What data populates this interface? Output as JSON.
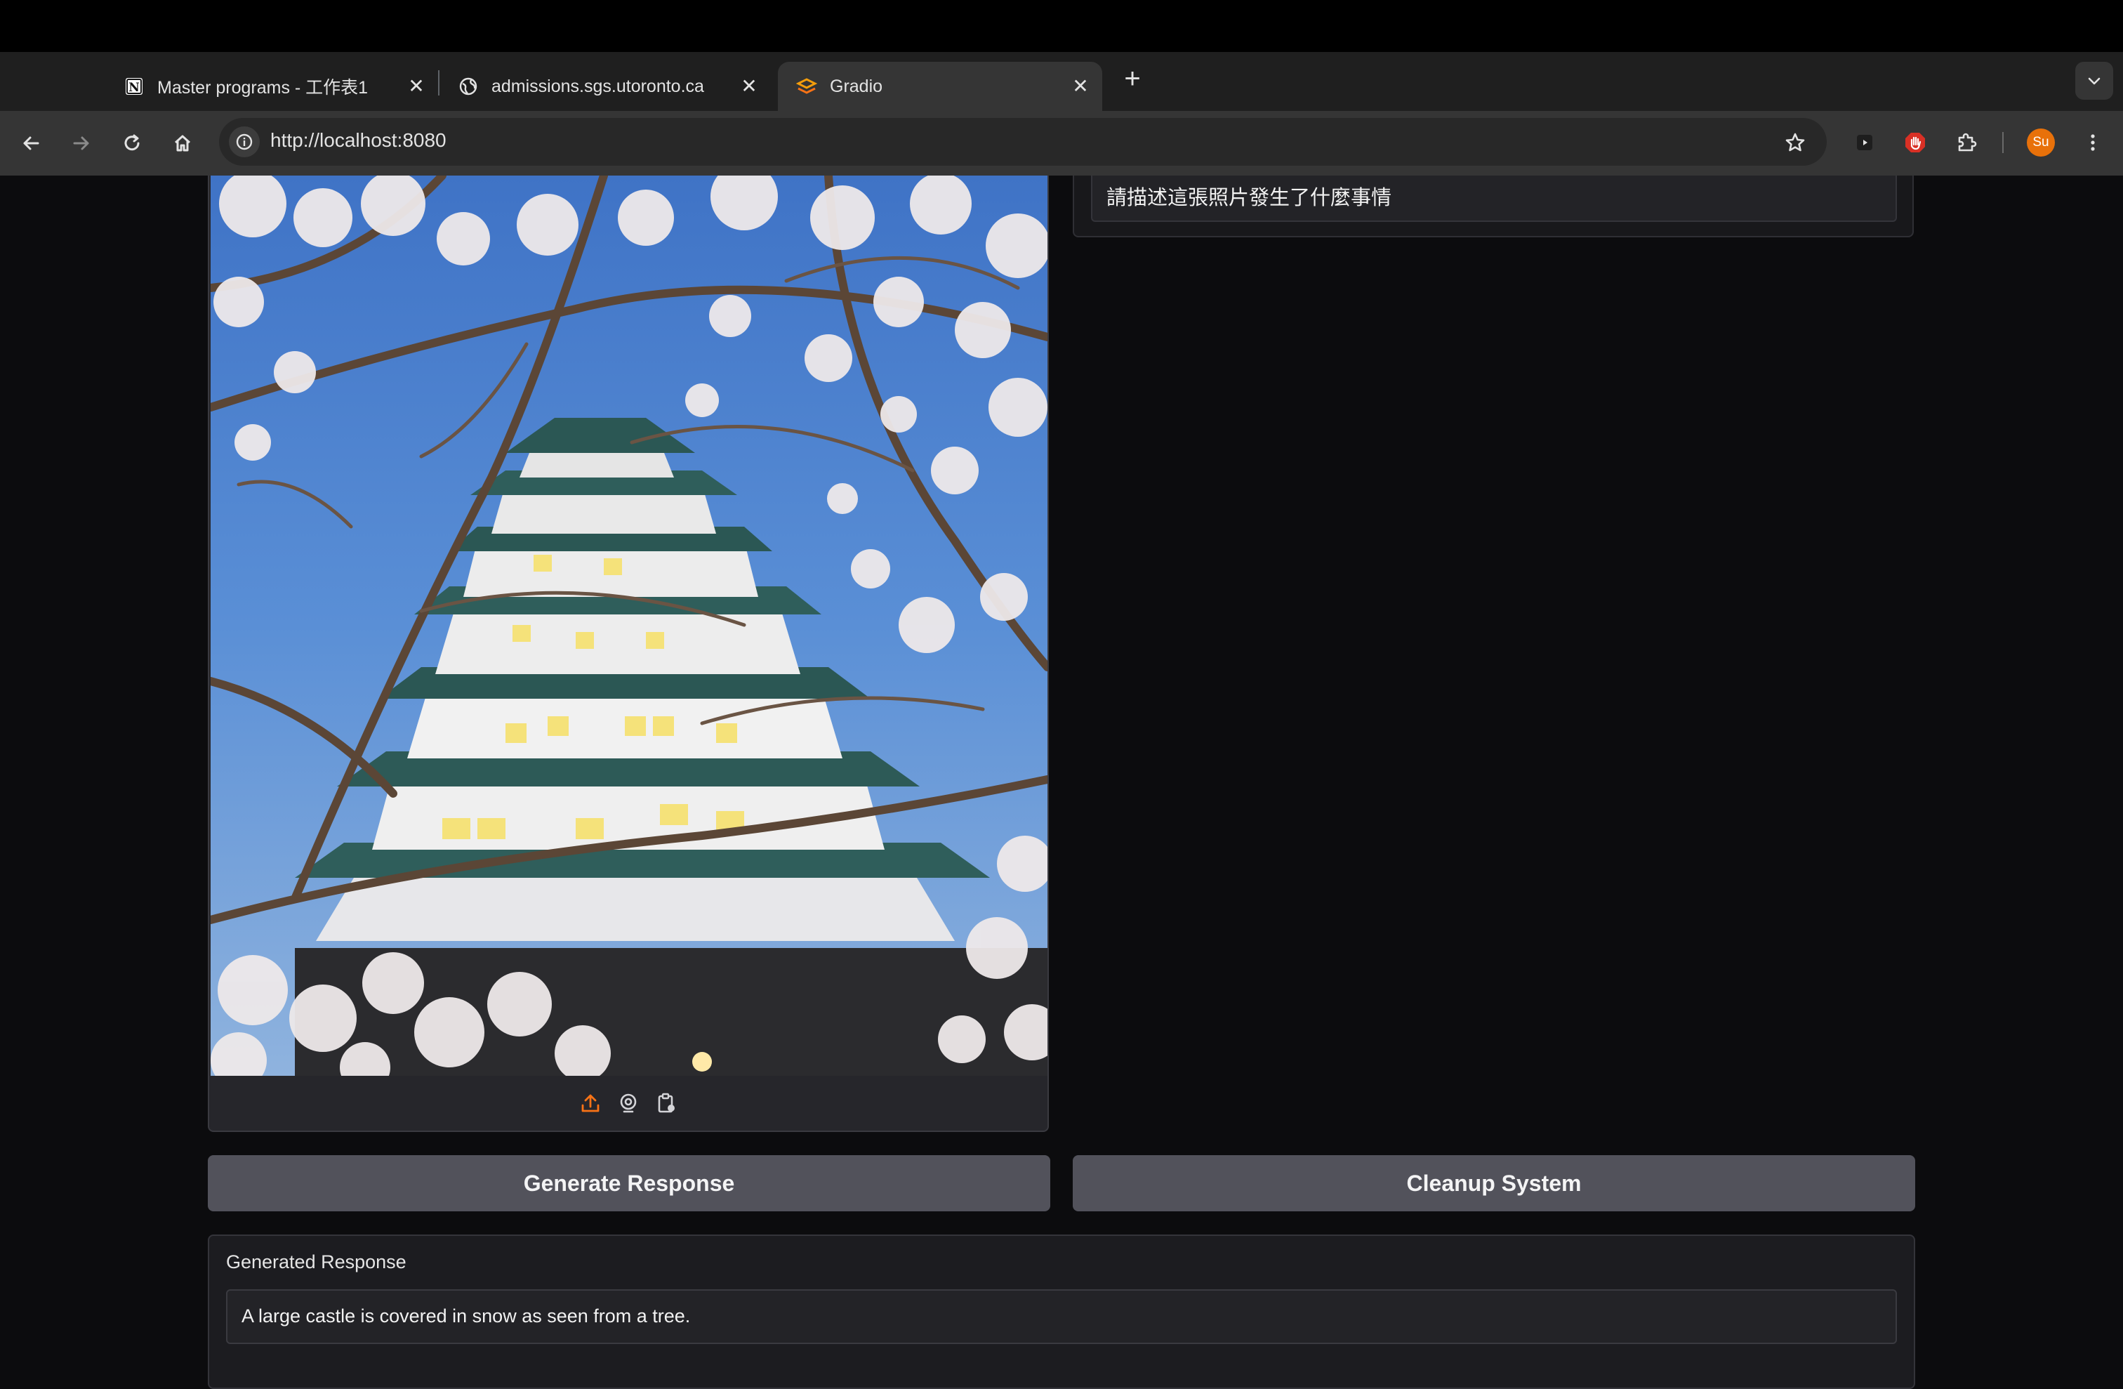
{
  "browser": {
    "tabs": [
      {
        "title": "Master programs - 工作表1",
        "favicon": "notion-icon"
      },
      {
        "title": "admissions.sgs.utoronto.ca",
        "favicon": "globe-icon"
      },
      {
        "title": "Gradio",
        "favicon": "gradio-icon",
        "active": true
      }
    ],
    "url": "http://localhost:8080",
    "profile_initials": "Su",
    "accent_color": "#e8710a"
  },
  "page": {
    "prompt": {
      "value": "請描述這張照片發生了什麼事情"
    },
    "image_input": {
      "tools": [
        "upload-icon",
        "webcam-icon",
        "clipboard-icon"
      ]
    },
    "buttons": {
      "generate": "Generate Response",
      "cleanup": "Cleanup System"
    },
    "response": {
      "label": "Generated Response",
      "value": "A large castle is covered in snow as seen from a tree."
    }
  }
}
